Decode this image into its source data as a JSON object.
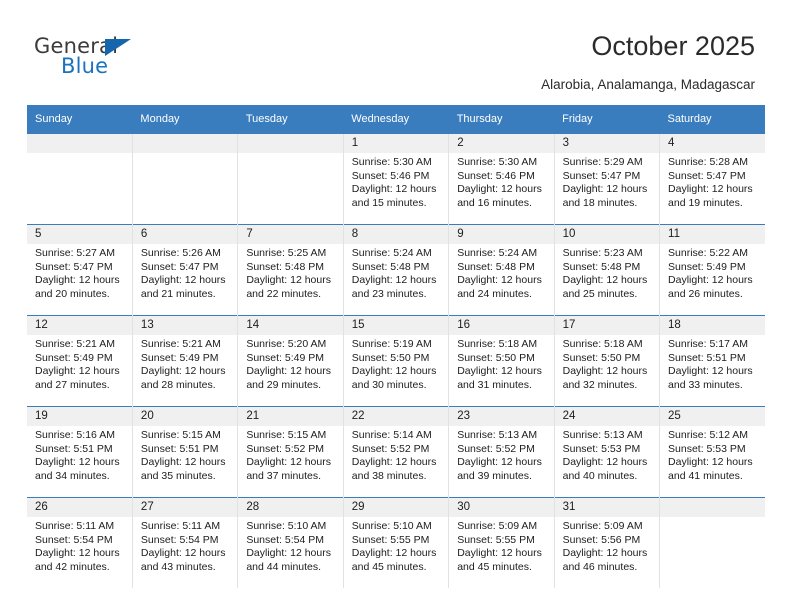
{
  "brand": {
    "name_top": "General",
    "name_bottom": "Blue",
    "accent_color": "#1566ad",
    "text_color": "#3b3b3b"
  },
  "header": {
    "title": "October 2025",
    "subtitle": "Alarobia, Analamanga, Madagascar"
  },
  "theme": {
    "header_bar_color": "#3a7dbf",
    "daynum_strip_color": "#f0f0f0",
    "cell_background": "#ffffff",
    "grid_line_color": "#e2e2e2"
  },
  "weekday_headers": [
    "Sunday",
    "Monday",
    "Tuesday",
    "Wednesday",
    "Thursday",
    "Friday",
    "Saturday"
  ],
  "labels": {
    "sunrise_prefix": "Sunrise:",
    "sunset_prefix": "Sunset:",
    "daylight_prefix": "Daylight:"
  },
  "weeks": [
    [
      {
        "day": "",
        "blank": true
      },
      {
        "day": "",
        "blank": true
      },
      {
        "day": "",
        "blank": true
      },
      {
        "day": "1",
        "sunrise": "Sunrise: 5:30 AM",
        "sunset": "Sunset: 5:46 PM",
        "daylight": "Daylight: 12 hours and 15 minutes."
      },
      {
        "day": "2",
        "sunrise": "Sunrise: 5:30 AM",
        "sunset": "Sunset: 5:46 PM",
        "daylight": "Daylight: 12 hours and 16 minutes."
      },
      {
        "day": "3",
        "sunrise": "Sunrise: 5:29 AM",
        "sunset": "Sunset: 5:47 PM",
        "daylight": "Daylight: 12 hours and 18 minutes."
      },
      {
        "day": "4",
        "sunrise": "Sunrise: 5:28 AM",
        "sunset": "Sunset: 5:47 PM",
        "daylight": "Daylight: 12 hours and 19 minutes."
      }
    ],
    [
      {
        "day": "5",
        "sunrise": "Sunrise: 5:27 AM",
        "sunset": "Sunset: 5:47 PM",
        "daylight": "Daylight: 12 hours and 20 minutes."
      },
      {
        "day": "6",
        "sunrise": "Sunrise: 5:26 AM",
        "sunset": "Sunset: 5:47 PM",
        "daylight": "Daylight: 12 hours and 21 minutes."
      },
      {
        "day": "7",
        "sunrise": "Sunrise: 5:25 AM",
        "sunset": "Sunset: 5:48 PM",
        "daylight": "Daylight: 12 hours and 22 minutes."
      },
      {
        "day": "8",
        "sunrise": "Sunrise: 5:24 AM",
        "sunset": "Sunset: 5:48 PM",
        "daylight": "Daylight: 12 hours and 23 minutes."
      },
      {
        "day": "9",
        "sunrise": "Sunrise: 5:24 AM",
        "sunset": "Sunset: 5:48 PM",
        "daylight": "Daylight: 12 hours and 24 minutes."
      },
      {
        "day": "10",
        "sunrise": "Sunrise: 5:23 AM",
        "sunset": "Sunset: 5:48 PM",
        "daylight": "Daylight: 12 hours and 25 minutes."
      },
      {
        "day": "11",
        "sunrise": "Sunrise: 5:22 AM",
        "sunset": "Sunset: 5:49 PM",
        "daylight": "Daylight: 12 hours and 26 minutes."
      }
    ],
    [
      {
        "day": "12",
        "sunrise": "Sunrise: 5:21 AM",
        "sunset": "Sunset: 5:49 PM",
        "daylight": "Daylight: 12 hours and 27 minutes."
      },
      {
        "day": "13",
        "sunrise": "Sunrise: 5:21 AM",
        "sunset": "Sunset: 5:49 PM",
        "daylight": "Daylight: 12 hours and 28 minutes."
      },
      {
        "day": "14",
        "sunrise": "Sunrise: 5:20 AM",
        "sunset": "Sunset: 5:49 PM",
        "daylight": "Daylight: 12 hours and 29 minutes."
      },
      {
        "day": "15",
        "sunrise": "Sunrise: 5:19 AM",
        "sunset": "Sunset: 5:50 PM",
        "daylight": "Daylight: 12 hours and 30 minutes."
      },
      {
        "day": "16",
        "sunrise": "Sunrise: 5:18 AM",
        "sunset": "Sunset: 5:50 PM",
        "daylight": "Daylight: 12 hours and 31 minutes."
      },
      {
        "day": "17",
        "sunrise": "Sunrise: 5:18 AM",
        "sunset": "Sunset: 5:50 PM",
        "daylight": "Daylight: 12 hours and 32 minutes."
      },
      {
        "day": "18",
        "sunrise": "Sunrise: 5:17 AM",
        "sunset": "Sunset: 5:51 PM",
        "daylight": "Daylight: 12 hours and 33 minutes."
      }
    ],
    [
      {
        "day": "19",
        "sunrise": "Sunrise: 5:16 AM",
        "sunset": "Sunset: 5:51 PM",
        "daylight": "Daylight: 12 hours and 34 minutes."
      },
      {
        "day": "20",
        "sunrise": "Sunrise: 5:15 AM",
        "sunset": "Sunset: 5:51 PM",
        "daylight": "Daylight: 12 hours and 35 minutes."
      },
      {
        "day": "21",
        "sunrise": "Sunrise: 5:15 AM",
        "sunset": "Sunset: 5:52 PM",
        "daylight": "Daylight: 12 hours and 37 minutes."
      },
      {
        "day": "22",
        "sunrise": "Sunrise: 5:14 AM",
        "sunset": "Sunset: 5:52 PM",
        "daylight": "Daylight: 12 hours and 38 minutes."
      },
      {
        "day": "23",
        "sunrise": "Sunrise: 5:13 AM",
        "sunset": "Sunset: 5:52 PM",
        "daylight": "Daylight: 12 hours and 39 minutes."
      },
      {
        "day": "24",
        "sunrise": "Sunrise: 5:13 AM",
        "sunset": "Sunset: 5:53 PM",
        "daylight": "Daylight: 12 hours and 40 minutes."
      },
      {
        "day": "25",
        "sunrise": "Sunrise: 5:12 AM",
        "sunset": "Sunset: 5:53 PM",
        "daylight": "Daylight: 12 hours and 41 minutes."
      }
    ],
    [
      {
        "day": "26",
        "sunrise": "Sunrise: 5:11 AM",
        "sunset": "Sunset: 5:54 PM",
        "daylight": "Daylight: 12 hours and 42 minutes."
      },
      {
        "day": "27",
        "sunrise": "Sunrise: 5:11 AM",
        "sunset": "Sunset: 5:54 PM",
        "daylight": "Daylight: 12 hours and 43 minutes."
      },
      {
        "day": "28",
        "sunrise": "Sunrise: 5:10 AM",
        "sunset": "Sunset: 5:54 PM",
        "daylight": "Daylight: 12 hours and 44 minutes."
      },
      {
        "day": "29",
        "sunrise": "Sunrise: 5:10 AM",
        "sunset": "Sunset: 5:55 PM",
        "daylight": "Daylight: 12 hours and 45 minutes."
      },
      {
        "day": "30",
        "sunrise": "Sunrise: 5:09 AM",
        "sunset": "Sunset: 5:55 PM",
        "daylight": "Daylight: 12 hours and 45 minutes."
      },
      {
        "day": "31",
        "sunrise": "Sunrise: 5:09 AM",
        "sunset": "Sunset: 5:56 PM",
        "daylight": "Daylight: 12 hours and 46 minutes."
      },
      {
        "day": "",
        "blank": true
      }
    ]
  ]
}
